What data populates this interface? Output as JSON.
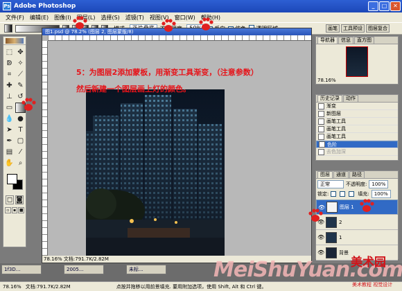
{
  "window": {
    "title": "Adobe Photoshop",
    "app_icon": "Ps"
  },
  "menu": [
    "文件(F)",
    "编辑(E)",
    "图像(I)",
    "图层(L)",
    "选择(S)",
    "滤镜(T)",
    "视图(V)",
    "窗口(W)",
    "帮助(H)"
  ],
  "options": {
    "mode_label": "模式:",
    "mode_value": "正片叠底",
    "opacity_label": "不透明度:",
    "opacity_value": "50%",
    "reverse": "反向",
    "dither": "仿色",
    "transparency": "透明区域"
  },
  "palette_well": [
    "画笔",
    "工具预设",
    "图层复合"
  ],
  "document": {
    "title": "图1.psd @ 78.2% (图层 2, 图层蒙版/8)",
    "status": "78.16%  文档:791.7K/2.82M"
  },
  "annotation": {
    "line1": "5：为图层2添加蒙板，用渐变工具渐变，（注意参数）",
    "line2": "然后新建一个图层画上灯的颜色。"
  },
  "navigator": {
    "tabs": [
      "导航器",
      "信息",
      "直方图"
    ],
    "zoom": "78.16%"
  },
  "history": {
    "tabs": [
      "历史记录",
      "动作"
    ],
    "items": [
      {
        "label": "渐变",
        "state": "normal"
      },
      {
        "label": "新图层",
        "state": "normal"
      },
      {
        "label": "画笔工具",
        "state": "normal"
      },
      {
        "label": "画笔工具",
        "state": "normal"
      },
      {
        "label": "画笔工具",
        "state": "normal"
      },
      {
        "label": "色阶",
        "state": "selected"
      },
      {
        "label": "去色加深",
        "state": "dim"
      }
    ]
  },
  "layers": {
    "tabs": [
      "图层",
      "通道",
      "路径"
    ],
    "blend": "正常",
    "opacity_label": "不透明度:",
    "opacity": "100%",
    "lock_label": "锁定:",
    "fill_label": "填充:",
    "fill": "100%",
    "items": [
      {
        "name": "图层 1",
        "selected": true
      },
      {
        "name": "2",
        "selected": false
      },
      {
        "name": "1",
        "selected": false
      },
      {
        "name": "背景",
        "selected": false
      }
    ]
  },
  "taskbar": {
    "tasks": [
      "1f3D...",
      "2005...",
      "未标..."
    ]
  },
  "statusbar": {
    "zoom": "78.16%",
    "doc": "文档:791.7K/2.82M",
    "hint": "点按并拖移以用前景填充. 要用附加选项，使用 Shift, Alt 和 Ctrl 键。"
  },
  "watermark": {
    "text": "MeiShuYuan.com",
    "brand": "美术园",
    "sub": "美术教程 视觉设计"
  },
  "colors": {
    "accent": "#e6141a",
    "titlebar": "#1c47b8",
    "paw": "#e02020"
  }
}
